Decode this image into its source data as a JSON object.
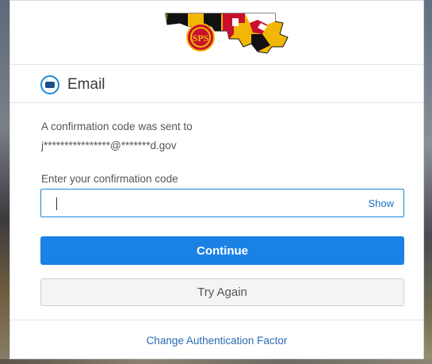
{
  "logo": {
    "badge_text": "SPS",
    "brand_colors": {
      "red": "#c8102e",
      "gold": "#f2b705",
      "black": "#111111"
    }
  },
  "factor": {
    "icon": "envelope-icon",
    "title": "Email"
  },
  "confirmation": {
    "line1": "A confirmation code was sent to",
    "line2": "j****************@*******d.gov"
  },
  "code_field": {
    "label": "Enter your confirmation code",
    "value": "",
    "placeholder": "",
    "show_label": "Show"
  },
  "buttons": {
    "continue_label": "Continue",
    "try_again_label": "Try Again"
  },
  "footer": {
    "change_factor_label": "Change Authentication Factor"
  },
  "colors": {
    "accent": "#1a82e5",
    "link": "#2a6bb5",
    "input_border": "#1a8ad8"
  }
}
